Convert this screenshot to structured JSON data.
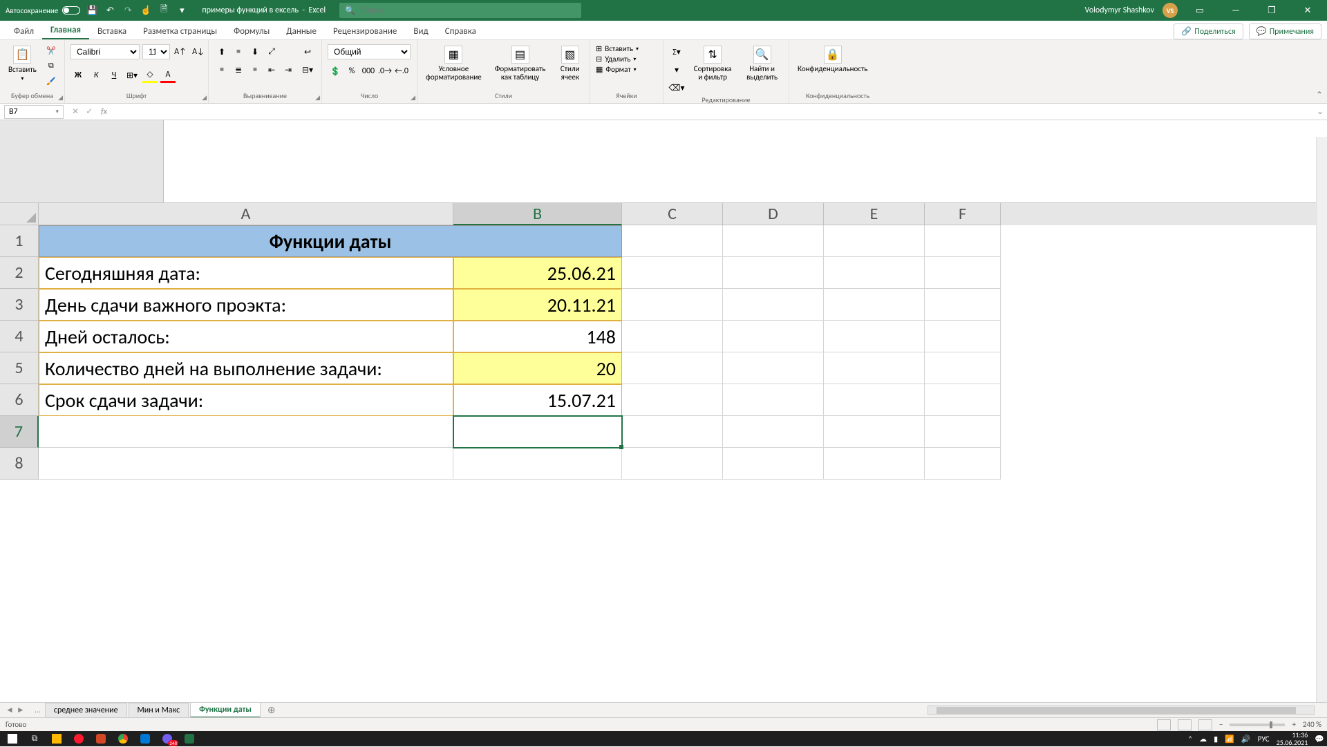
{
  "titlebar": {
    "autosave_label": "Автосохранение",
    "doc_name": "примеры функций в ексель",
    "app_suffix": "Excel",
    "search_placeholder": "Поиск",
    "user_name": "Volodymyr Shashkov",
    "user_initials": "VS"
  },
  "ribbon": {
    "tabs": [
      "Файл",
      "Главная",
      "Вставка",
      "Разметка страницы",
      "Формулы",
      "Данные",
      "Рецензирование",
      "Вид",
      "Справка"
    ],
    "share": "Поделиться",
    "comments": "Примечания",
    "groups": {
      "clipboard": {
        "label": "Буфер обмена",
        "paste": "Вставить"
      },
      "font": {
        "label": "Шрифт",
        "name": "Calibri",
        "size": "11"
      },
      "alignment": {
        "label": "Выравнивание"
      },
      "number": {
        "label": "Число",
        "format": "Общий"
      },
      "styles": {
        "label": "Стили",
        "conditional": "Условное форматирование",
        "table": "Форматировать как таблицу",
        "cell_styles": "Стили ячеек"
      },
      "cells": {
        "label": "Ячейки",
        "insert": "Вставить",
        "delete": "Удалить",
        "format": "Формат"
      },
      "editing": {
        "label": "Редактирование",
        "sort": "Сортировка и фильтр",
        "find": "Найти и выделить"
      },
      "confidentiality": {
        "label": "Конфиденциальность",
        "btn": "Конфиденциальность"
      }
    }
  },
  "formula_bar": {
    "name_box": "B7",
    "formula": ""
  },
  "columns": [
    "A",
    "B",
    "C",
    "D",
    "E",
    "F"
  ],
  "rows": [
    "1",
    "2",
    "3",
    "4",
    "5",
    "6",
    "7",
    "8"
  ],
  "selected_col_index": 1,
  "selected_row_index": 6,
  "cells": {
    "title": "Функции даты",
    "r2a": "Сегодняшняя дата:",
    "r2b": "25.06.21",
    "r3a": "День сдачи важного проэкта:",
    "r3b": "20.11.21",
    "r4a": "Дней осталось:",
    "r4b": "148",
    "r5a": "Количество дней на выполнение задачи:",
    "r5b": "20",
    "r6a": "Срок сдачи задачи:",
    "r6b": "15.07.21"
  },
  "sheets": {
    "tabs": [
      "среднее значение",
      "Мин и Макс",
      "Функции даты"
    ],
    "active_index": 2,
    "ellipsis": "..."
  },
  "status": {
    "ready": "Готово",
    "zoom": "240 %"
  },
  "taskbar": {
    "lang": "РУС",
    "time": "11:36",
    "date": "25.06.2021",
    "viber_badge": "248"
  }
}
